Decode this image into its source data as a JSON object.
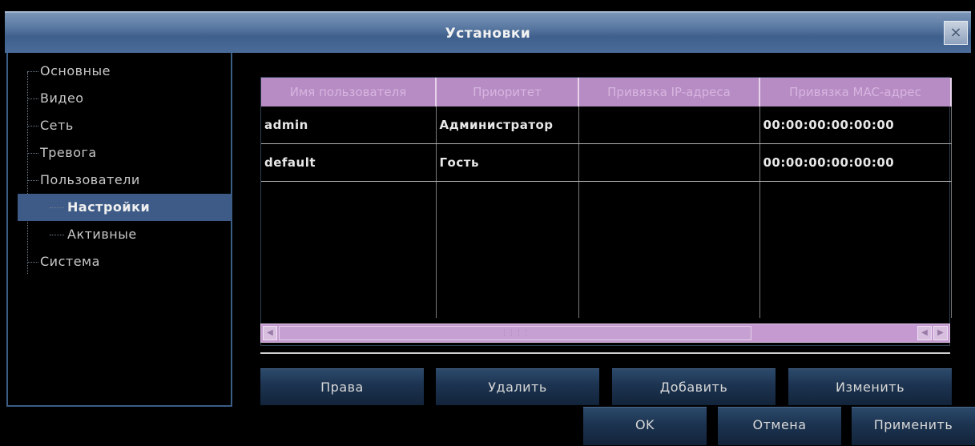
{
  "window": {
    "title": "Установки",
    "close_label": "×"
  },
  "sidebar": {
    "items": [
      {
        "label": "Основные",
        "level": 0,
        "selected": false
      },
      {
        "label": "Видео",
        "level": 0,
        "selected": false
      },
      {
        "label": "Сеть",
        "level": 0,
        "selected": false
      },
      {
        "label": "Тревога",
        "level": 0,
        "selected": false
      },
      {
        "label": "Пользователи",
        "level": 0,
        "selected": false
      },
      {
        "label": "Настройки",
        "level": 1,
        "selected": true
      },
      {
        "label": "Активные",
        "level": 1,
        "selected": false
      },
      {
        "label": "Система",
        "level": 0,
        "selected": false
      }
    ]
  },
  "users_table": {
    "columns": [
      "Имя пользователя",
      "Приоритет",
      "Привязка IP-адреса",
      "Привязка MAC-адрес"
    ],
    "rows": [
      [
        "admin",
        "Администратор",
        "",
        "00:00:00:00:00:00"
      ],
      [
        "default",
        "Гость",
        "",
        "00:00:00:00:00:00"
      ]
    ]
  },
  "actions": {
    "rights": "Права",
    "delete": "Удалить",
    "add": "Добавить",
    "edit": "Изменить"
  },
  "footer": {
    "ok": "OK",
    "cancel": "Отмена",
    "apply": "Применить"
  },
  "colors": {
    "title_bar": "#5b7aa3",
    "selected": "#3d5b86",
    "table_header": "#b78cc4"
  }
}
